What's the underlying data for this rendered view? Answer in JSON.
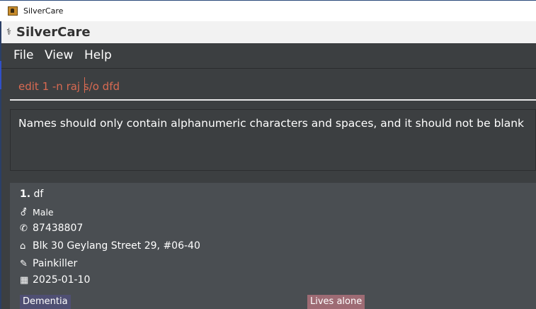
{
  "window": {
    "title": "SilverCare"
  },
  "app": {
    "name": "SilverCare"
  },
  "menu": [
    "File",
    "View",
    "Help"
  ],
  "command": {
    "text": "edit 1 -n raj s/o dfd"
  },
  "result": {
    "message": "Names should only contain alphanumeric characters and spaces, and it should not be blank"
  },
  "persons": [
    {
      "index": "1.",
      "name": "df",
      "gender": "Male",
      "phone": "87438807",
      "address": "Blk 30 Geylang Street 29, #06-40",
      "medication": "Painkiller",
      "date": "2025-01-10",
      "tags": [
        "Dementia",
        "Lives alone"
      ]
    }
  ],
  "colors": {
    "tag_dementia": "#4f4f73",
    "tag_lives_alone": "#9e6b74",
    "command_text": "#d96a52"
  },
  "icons": {
    "app": "app-icon",
    "gender": "gender-icon",
    "phone": "phone-icon",
    "address": "home-icon",
    "medication": "pill-icon",
    "date": "calendar-icon"
  }
}
